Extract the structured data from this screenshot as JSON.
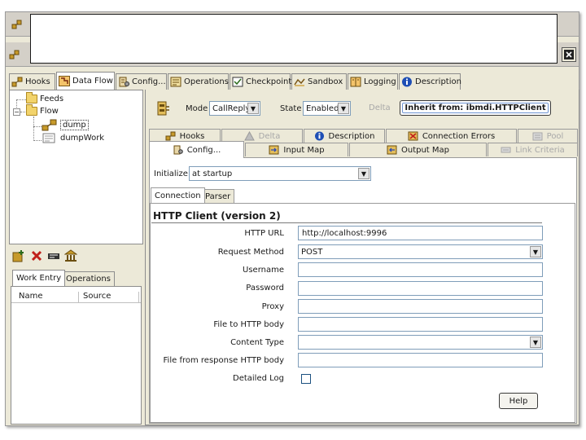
{
  "main_tabs": [
    {
      "label": "Hooks",
      "icon": "hooks-icon"
    },
    {
      "label": "Data Flow",
      "icon": "data-flow-icon",
      "active": true
    },
    {
      "label": "Config...",
      "icon": "config-icon"
    },
    {
      "label": "Operations",
      "icon": "operations-icon"
    },
    {
      "label": "Checkpoint",
      "icon": "checkpoint-icon"
    },
    {
      "label": "Sandbox",
      "icon": "sandbox-icon"
    },
    {
      "label": "Logging",
      "icon": "logging-icon"
    },
    {
      "label": "Description",
      "icon": "info-icon"
    }
  ],
  "tree": {
    "feeds": "Feeds",
    "flow": "Flow",
    "dump": "dump",
    "dumpwork": "dumpWork"
  },
  "left_tabs": {
    "work_entry": "Work Entry",
    "operations": "Operations"
  },
  "work_columns": {
    "name": "Name",
    "source": "Source"
  },
  "mode": {
    "label": "Mode",
    "value": "CallReply"
  },
  "state": {
    "label": "State",
    "value": "Enabled"
  },
  "delta_label": "Delta",
  "inherit_button": "Inherit from: ibmdi.HTTPClient",
  "right_tabs_row1": [
    "Hooks",
    "Delta",
    "Description",
    "Connection Errors",
    "Pool"
  ],
  "right_tabs_row2": [
    "Config...",
    "Input Map",
    "Output Map",
    "Link Criteria"
  ],
  "initialize": {
    "label": "Initialize",
    "value": "at startup"
  },
  "sub_tabs": [
    "Connection",
    "Parser"
  ],
  "section_title": "HTTP Client (version 2)",
  "form": {
    "http_url": {
      "label": "HTTP URL",
      "value": "http://localhost:9996"
    },
    "request_method": {
      "label": "Request Method",
      "value": "POST"
    },
    "username": {
      "label": "Username",
      "value": ""
    },
    "password": {
      "label": "Password",
      "value": ""
    },
    "proxy": {
      "label": "Proxy",
      "value": ""
    },
    "file_to_http_body": {
      "label": "File to HTTP body",
      "value": ""
    },
    "content_type": {
      "label": "Content Type",
      "value": ""
    },
    "file_from_response": {
      "label": "File from response HTTP body",
      "value": ""
    },
    "detailed_log": {
      "label": "Detailed Log",
      "checked": false
    }
  },
  "help_button": "Help",
  "colors": {
    "panel": "#ece9d8",
    "input_border": "#7f9db9",
    "button_focus": "#6f94d2"
  }
}
